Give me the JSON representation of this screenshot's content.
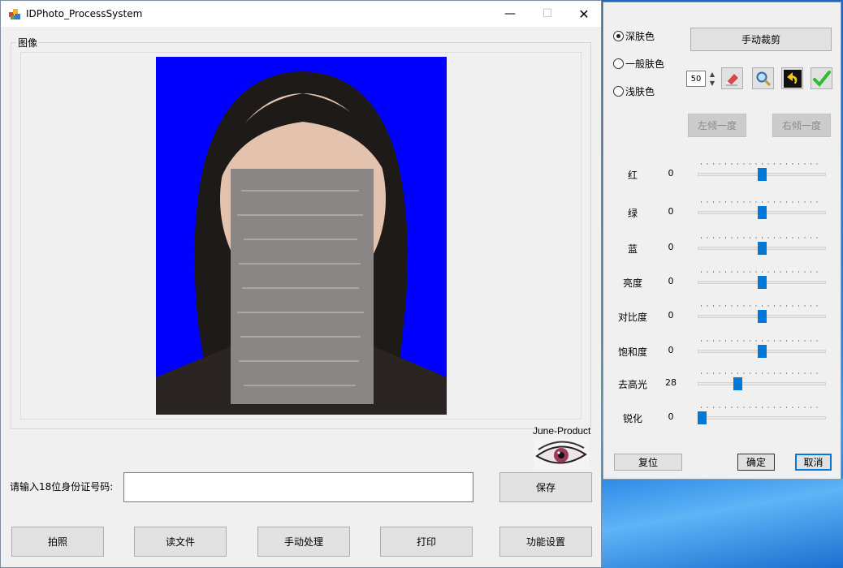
{
  "window": {
    "title": "IDPhoto_ProcessSystem",
    "minimize_glyph": "—",
    "maximize_glyph": "☐",
    "close_glyph": "✕"
  },
  "image_group": {
    "label": "图像"
  },
  "brand": {
    "label": "June-Product"
  },
  "id_entry": {
    "label": "请输入18位身份证号码:",
    "value": ""
  },
  "buttons": {
    "save": "保存",
    "capture": "拍照",
    "read_file": "读文件",
    "manual_process": "手动处理",
    "print": "打印",
    "settings": "功能设置"
  },
  "side_panel": {
    "skin_tones": [
      {
        "label": "深肤色",
        "checked": true
      },
      {
        "label": "一般肤色",
        "checked": false
      },
      {
        "label": "浅肤色",
        "checked": false
      }
    ],
    "manual_crop": "手动裁剪",
    "brush_size": "50",
    "tilt_left": "左倾一度",
    "tilt_right": "右倾一度",
    "sliders": [
      {
        "label": "红",
        "value": "0",
        "level": 0.5
      },
      {
        "label": "绿",
        "value": "0",
        "level": 0.5
      },
      {
        "label": "蓝",
        "value": "0",
        "level": 0.5
      },
      {
        "label": "亮度",
        "value": "0",
        "level": 0.5
      },
      {
        "label": "对比度",
        "value": "0",
        "level": 0.5
      },
      {
        "label": "饱和度",
        "value": "0",
        "level": 0.5
      },
      {
        "label": "去高光",
        "value": "28",
        "level": 0.3
      },
      {
        "label": "锐化",
        "value": "0",
        "level": 0.0
      }
    ],
    "reset": "复位",
    "ok": "确定",
    "cancel": "取消"
  },
  "colors": {
    "photo_background": "#0000ff",
    "slider_thumb": "#0078d7",
    "confirm_check": "#2ebd2e"
  }
}
